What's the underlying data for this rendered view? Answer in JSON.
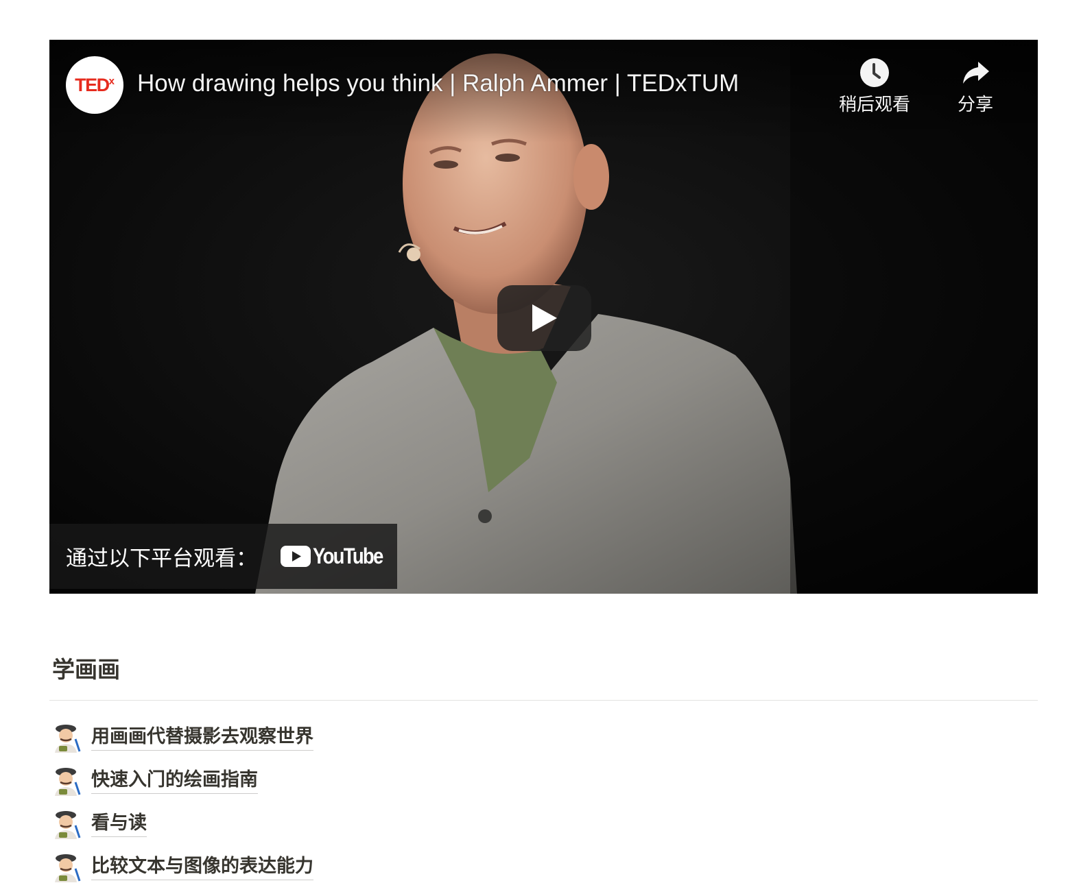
{
  "video": {
    "channel": "TEDx",
    "title": "How drawing helps you think | Ralph Ammer | TEDxTUM",
    "actions": {
      "watch_later": "稍后观看",
      "share": "分享"
    },
    "watch_on_label": "通过以下平台观看：",
    "platform": "YouTube",
    "icons": {
      "watch_later": "clock-icon",
      "share": "share-arrow-icon",
      "play": "play-icon",
      "youtube": "youtube-logo-icon"
    },
    "colors": {
      "ted_red": "#e62b1e",
      "youtube_red": "#ff0000"
    }
  },
  "section": {
    "heading": "学画画",
    "items": [
      {
        "icon": "artist-emoji-icon",
        "label": "用画画代替摄影去观察世界"
      },
      {
        "icon": "artist-emoji-icon",
        "label": "快速入门的绘画指南"
      },
      {
        "icon": "artist-emoji-icon",
        "label": "看与读"
      },
      {
        "icon": "artist-emoji-icon",
        "label": "比较文本与图像的表达能力"
      }
    ]
  }
}
